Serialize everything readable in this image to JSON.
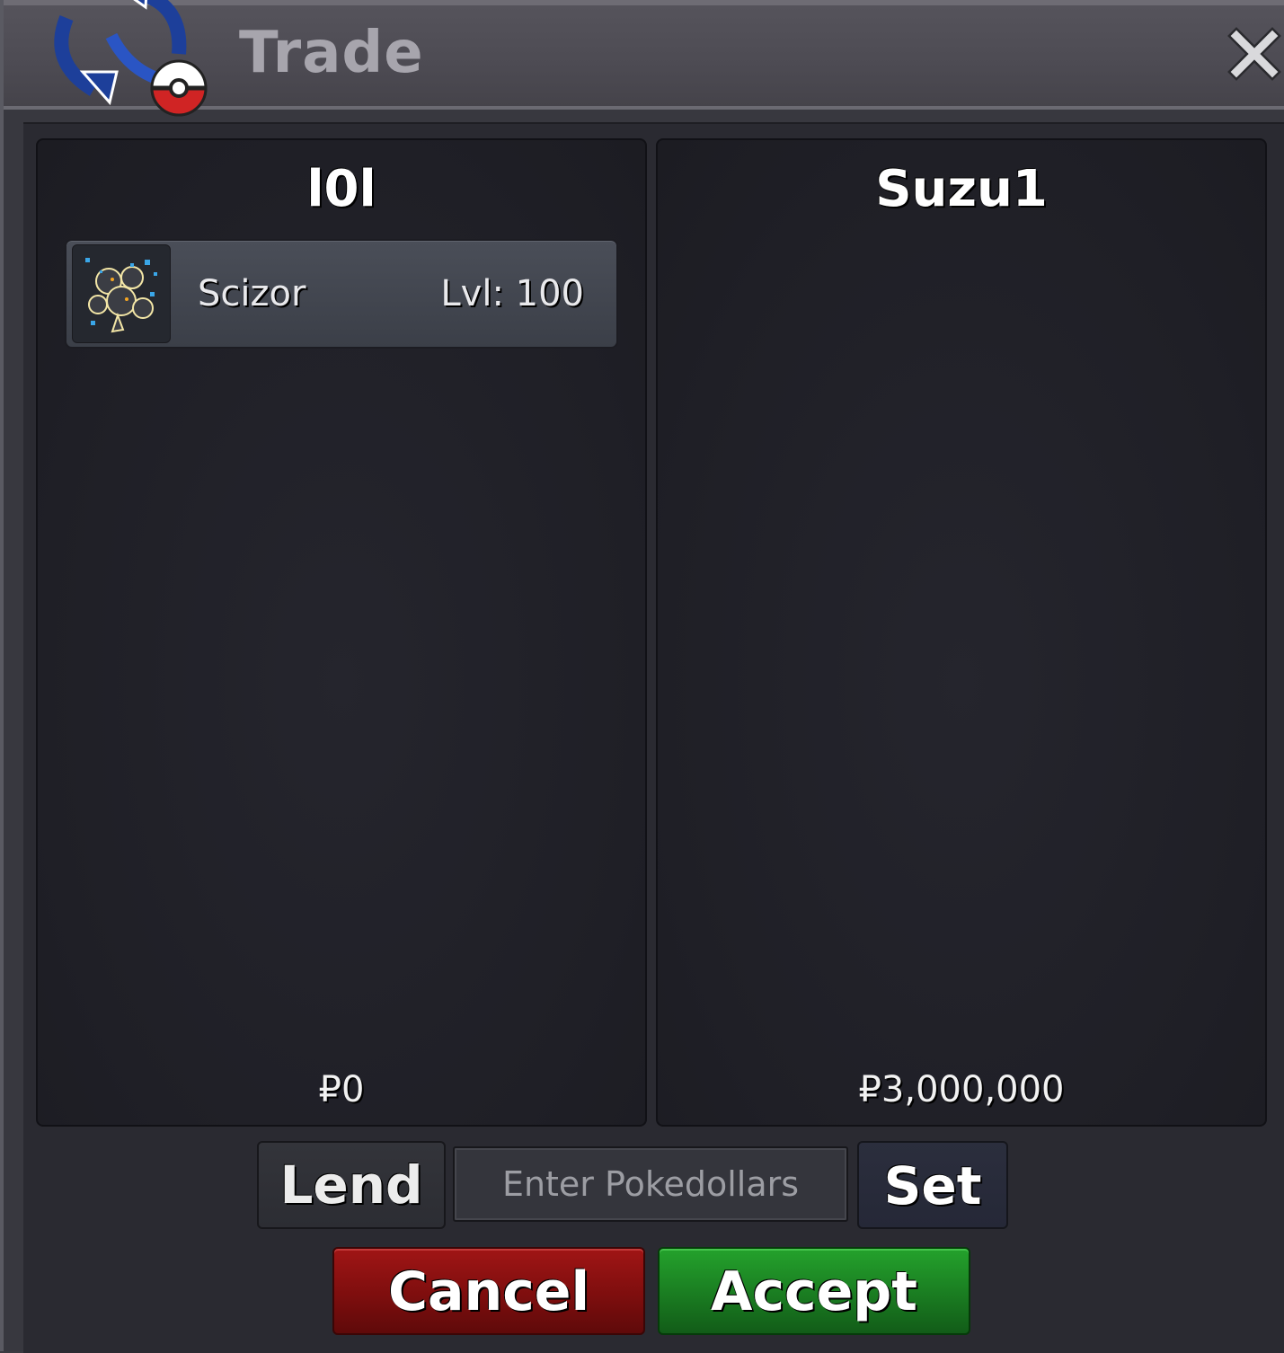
{
  "window": {
    "title": "Trade",
    "logo_icon": "trade-swap-pokeball-icon",
    "close_icon": "close-icon"
  },
  "left_panel": {
    "player_name": "l0l",
    "items": [
      {
        "name": "Scizor",
        "level": "Lvl: 100",
        "icon": "scizor-sprite-icon"
      }
    ],
    "money": "₽0"
  },
  "right_panel": {
    "player_name": "Suzu1",
    "items": [],
    "money": "₽3,000,000"
  },
  "controls": {
    "lend_label": "Lend",
    "money_input_placeholder": "Enter Pokedollars",
    "set_label": "Set",
    "cancel_label": "Cancel",
    "accept_label": "Accept"
  },
  "colors": {
    "cancel": "#8b1010",
    "accept": "#1f8f26",
    "panel_bg": "#22222a"
  }
}
